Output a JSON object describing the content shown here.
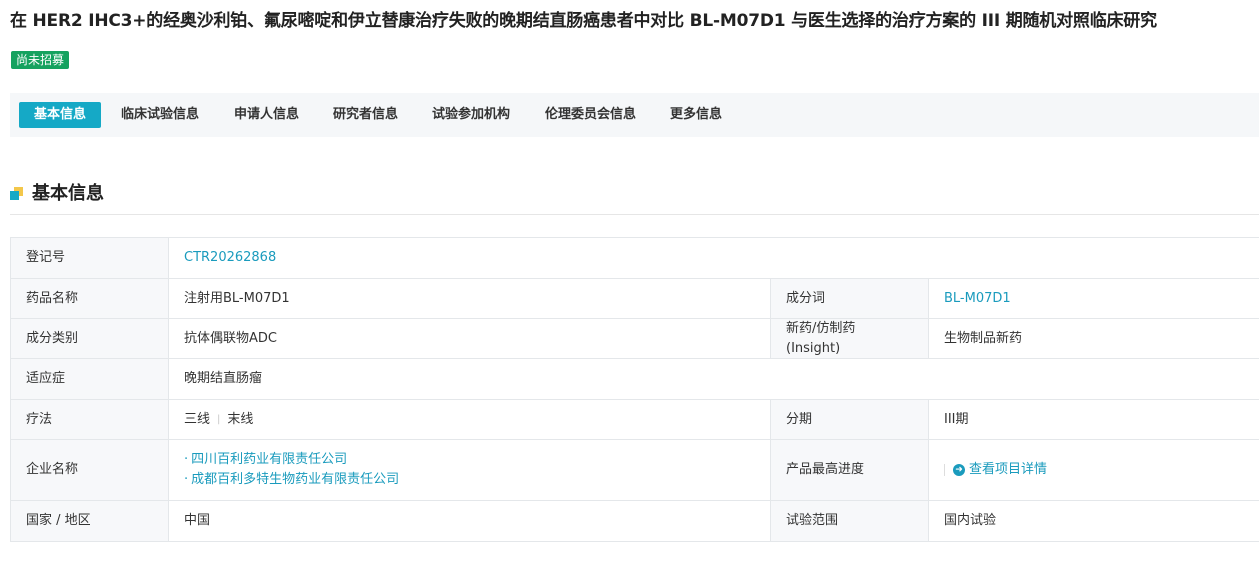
{
  "page": {
    "title": "在 HER2 IHC3+的经奥沙利铂、氟尿嘧啶和伊立替康治疗失败的晚期结直肠癌患者中对比 BL-M07D1 与医生选择的治疗方案的 III 期随机对照临床研究",
    "status_badge": "尚未招募"
  },
  "tabs": [
    {
      "label": "基本信息",
      "active": true
    },
    {
      "label": "临床试验信息",
      "active": false
    },
    {
      "label": "申请人信息",
      "active": false
    },
    {
      "label": "研究者信息",
      "active": false
    },
    {
      "label": "试验参加机构",
      "active": false
    },
    {
      "label": "伦理委员会信息",
      "active": false
    },
    {
      "label": "更多信息",
      "active": false
    }
  ],
  "section": {
    "title": "基本信息"
  },
  "table": {
    "reg_no_label": "登记号",
    "reg_no_value": "CTR20262868",
    "drug_name_label": "药品名称",
    "drug_name_value": "注射用BL-M07D1",
    "ingredient_label": "成分词",
    "ingredient_value": "BL-M07D1",
    "category_label": "成分类别",
    "category_value": "抗体偶联物ADC",
    "newdrug_label": "新药/仿制药 (Insight)",
    "newdrug_value": "生物制品新药",
    "indication_label": "适应症",
    "indication_value": "晚期结直肠瘤",
    "therapy_label": "疗法",
    "therapy_values": [
      "三线",
      "末线"
    ],
    "phase_label": "分期",
    "phase_value": "III期",
    "company_label": "企业名称",
    "companies": [
      "四川百利药业有限责任公司",
      "成都百利多特生物药业有限责任公司"
    ],
    "progress_label": "产品最高进度",
    "progress_link": "查看项目详情",
    "country_label": "国家 / 地区",
    "country_value": "中国",
    "scope_label": "试验范围",
    "scope_value": "国内试验"
  },
  "colors": {
    "accent": "#15a9c6",
    "badge": "#15a25f",
    "link": "#1a9bbd",
    "icon_yellow": "#f3c74a"
  },
  "icons": {
    "section_icon": "section-squares-icon",
    "detail_icon": "arrow-circle-right-icon"
  }
}
